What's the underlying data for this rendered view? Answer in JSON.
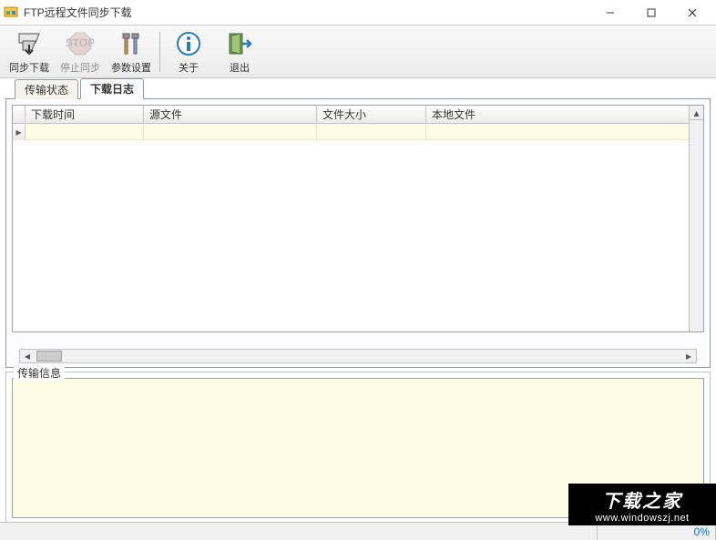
{
  "window": {
    "title": "FTP远程文件同步下载",
    "minimize": "–",
    "maximize": "☐",
    "close": "✕"
  },
  "toolbar": {
    "sync": "同步下载",
    "stop": "停止同步",
    "settings": "参数设置",
    "about": "关于",
    "exit": "退出"
  },
  "tabs": {
    "status": "传输状态",
    "log": "下载日志"
  },
  "table": {
    "headers": {
      "time": "下载时间",
      "source": "源文件",
      "size": "文件大小",
      "local": "本地文件"
    },
    "rows": [
      {
        "time": "",
        "source": "",
        "size": "",
        "local": ""
      }
    ]
  },
  "group": {
    "label": "传输信息",
    "content": ""
  },
  "status": {
    "left": "",
    "progress": "0%"
  },
  "watermark": {
    "big": "下载之家",
    "url": "www.windowszj.net"
  },
  "icons": {
    "app": "app-icon",
    "sync": "sync-down-icon",
    "stop": "stop-sign-icon",
    "settings": "tools-icon",
    "about": "info-icon",
    "exit": "exit-door-icon"
  }
}
